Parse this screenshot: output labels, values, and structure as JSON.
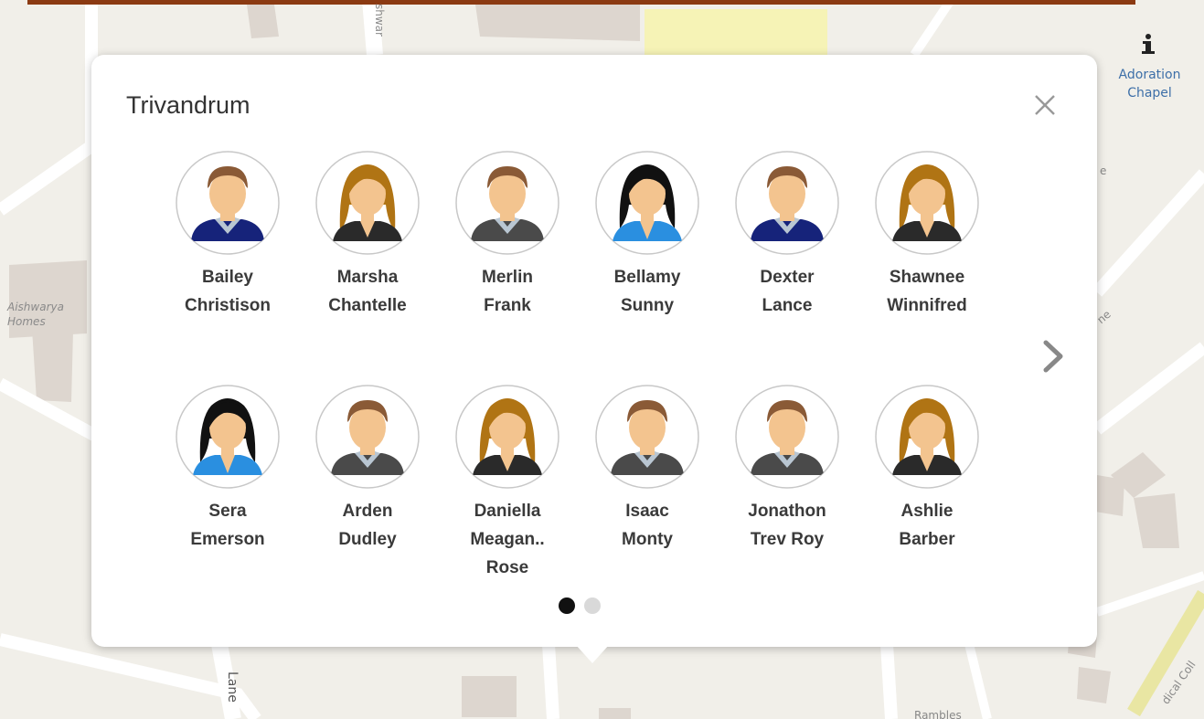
{
  "map": {
    "labels": {
      "aishwarya": "Aishwarya\nHomes",
      "road_top": "shwar",
      "road_bottom": "Lane",
      "road_right1": "e",
      "road_right2": "ne",
      "road_right3": "dical Coll",
      "road_bottom_right": "Rambles"
    },
    "poi": {
      "label": "Adoration Chapel",
      "icon": "info-icon"
    }
  },
  "popup": {
    "title": "Trivandrum",
    "close_icon": "close-icon",
    "next_icon": "chevron-right-icon",
    "people": [
      {
        "first": "Bailey",
        "last": "Christison",
        "avatar": "male-navy-sweater"
      },
      {
        "first": "Marsha",
        "last": "Chantelle",
        "avatar": "female-brown-hair"
      },
      {
        "first": "Merlin",
        "last": "Frank",
        "avatar": "male-gray-sweater"
      },
      {
        "first": "Bellamy",
        "last": "Sunny",
        "avatar": "female-black-hair-blue"
      },
      {
        "first": "Dexter",
        "last": "Lance",
        "avatar": "male-navy-sweater"
      },
      {
        "first": "Shawnee",
        "last": "Winnifred",
        "avatar": "female-brown-hair"
      },
      {
        "first": "Sera",
        "last": "Emerson",
        "avatar": "female-black-hair-blue"
      },
      {
        "first": "Arden",
        "last": "Dudley",
        "avatar": "male-gray-sweater"
      },
      {
        "first": "Daniella",
        "last": "Meagan..\nRose",
        "avatar": "female-brown-hair"
      },
      {
        "first": "Isaac",
        "last": "Monty",
        "avatar": "male-gray-sweater"
      },
      {
        "first": "Jonathon",
        "last": "Trev Roy",
        "avatar": "male-gray-sweater"
      },
      {
        "first": "Ashlie",
        "last": "Barber",
        "avatar": "female-brown-hair"
      }
    ],
    "pagination": {
      "pages": 2,
      "current": 1
    }
  },
  "colors": {
    "top_bar": "#8b3a12",
    "map_bg": "#f1efe9",
    "road": "#ffffff",
    "building": "#ddd6cf",
    "poi_text": "#3d6fa8",
    "dot_active": "#111111",
    "dot_inactive": "#d9d9d9",
    "skin": "#f3c48f",
    "hair_male": "#8a5a36",
    "hair_female_brown": "#b07414",
    "hair_black": "#111111",
    "sweater_navy": "#16237a",
    "sweater_gray": "#4a4a4a",
    "shirt_blue": "#2a8fe0",
    "collar": "#b9c6d2"
  }
}
